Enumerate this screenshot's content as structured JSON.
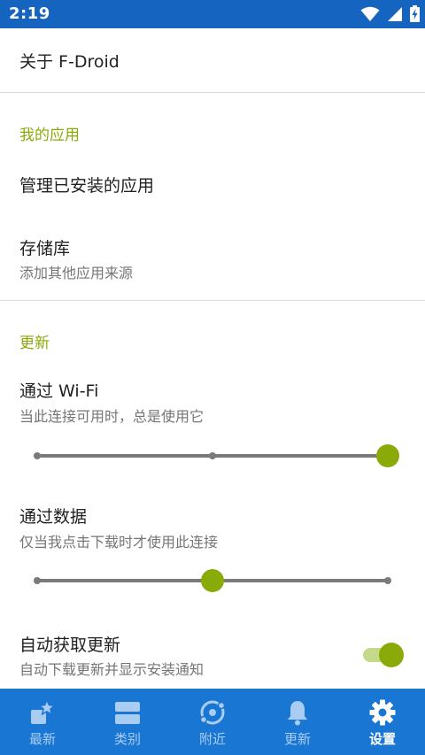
{
  "status_bar": {
    "time": "2:19"
  },
  "settings": {
    "about": {
      "title": "关于 F-Droid"
    },
    "my_apps": {
      "header": "我的应用",
      "manage_installed": {
        "title": "管理已安装的应用"
      },
      "repositories": {
        "title": "存储库",
        "subtitle": "添加其他应用来源"
      }
    },
    "updates": {
      "header": "更新",
      "over_wifi": {
        "title": "通过 Wi-Fi",
        "subtitle": "当此连接可用时，总是使用它",
        "level_index": 2,
        "levels": 3
      },
      "over_data": {
        "title": "通过数据",
        "subtitle": "仅当我点击下载时才使用此连接",
        "level_index": 1,
        "levels": 3
      },
      "auto_fetch": {
        "title": "自动获取更新",
        "subtitle": "自动下载更新并显示安装通知",
        "enabled": true
      }
    }
  },
  "colors": {
    "accent": "#8aaa0a",
    "primary": "#1976d2",
    "status_bar": "#1565c0"
  },
  "bottom_nav": {
    "items": [
      {
        "label": "最新",
        "icon": "latest-icon",
        "active": false
      },
      {
        "label": "类别",
        "icon": "categories-icon",
        "active": false
      },
      {
        "label": "附近",
        "icon": "nearby-icon",
        "active": false
      },
      {
        "label": "更新",
        "icon": "bell-icon",
        "active": false
      },
      {
        "label": "设置",
        "icon": "gear-icon",
        "active": true
      }
    ]
  }
}
